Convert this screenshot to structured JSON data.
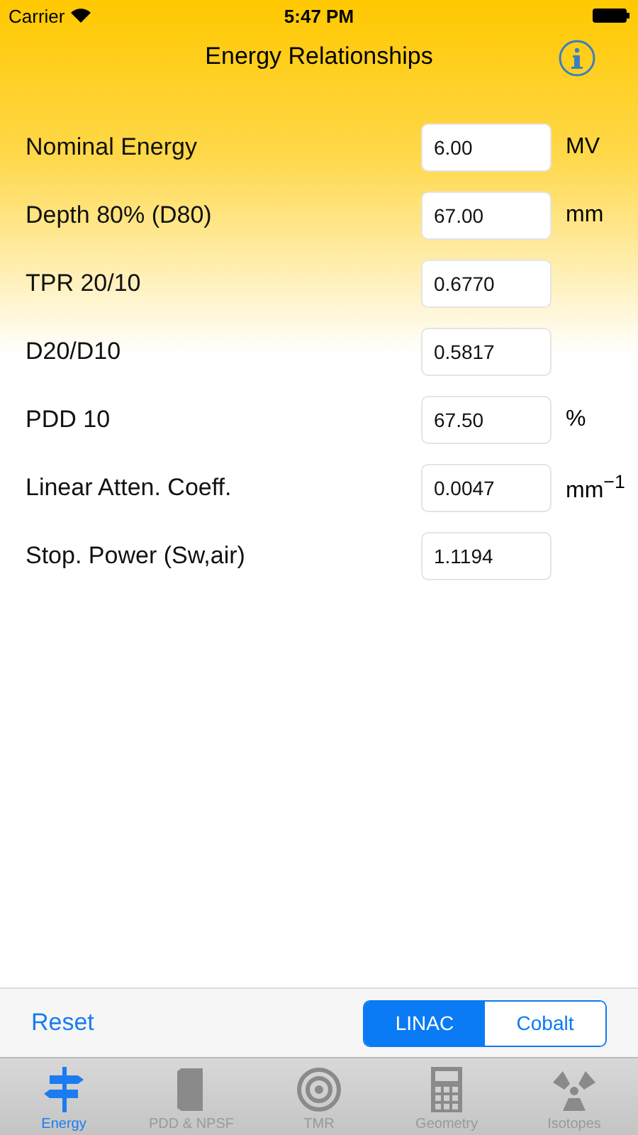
{
  "status_bar": {
    "carrier": "Carrier",
    "time": "5:47 PM"
  },
  "nav": {
    "title": "Energy Relationships"
  },
  "fields": [
    {
      "label": "Nominal Energy",
      "value": "6.00",
      "unit": "MV"
    },
    {
      "label": "Depth 80% (D80)",
      "value": "67.00",
      "unit": "mm"
    },
    {
      "label": "TPR 20/10",
      "value": "0.6770"
    },
    {
      "label": "D20/D10",
      "value": "0.5817"
    },
    {
      "label": "PDD 10",
      "value": "67.50",
      "unit": "%"
    },
    {
      "label": "Linear Atten. Coeff.",
      "value": "0.0047",
      "unit": "mm$^{−1}$"
    },
    {
      "label": "Stop. Power (Sw,air)",
      "value": "1.1194"
    }
  ],
  "toolbar": {
    "reset": "Reset",
    "segments": [
      {
        "label": "LINAC",
        "selected": true
      },
      {
        "label": "Cobalt",
        "selected": false
      }
    ]
  },
  "tabs": [
    {
      "kind": "signpost",
      "label": "Energy",
      "selected": true
    },
    {
      "kind": "book",
      "label": "PDD & NPSF",
      "selected": false
    },
    {
      "kind": "target",
      "label": "TMR",
      "selected": false
    },
    {
      "kind": "calculator",
      "label": "Geometry",
      "selected": false
    },
    {
      "kind": "radiation",
      "label": "Isotopes",
      "selected": false
    }
  ]
}
